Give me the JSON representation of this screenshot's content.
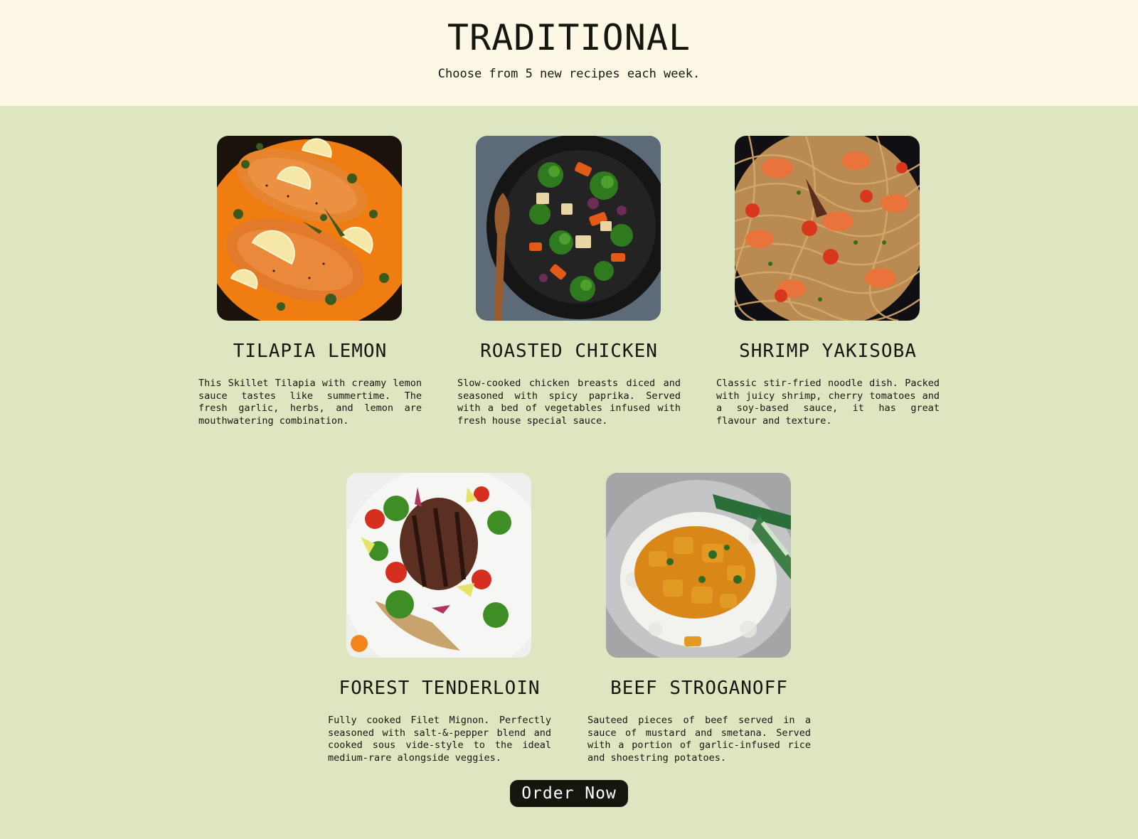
{
  "header": {
    "title": "TRADITIONAL",
    "subtitle": "Choose from 5 new recipes each week."
  },
  "recipes": [
    {
      "name": "TILAPIA LEMON",
      "description": "This Skillet Tilapia with creamy lemon sauce tastes like summertime. The fresh garlic, herbs, and lemon are mouthwatering combination.",
      "image": "salmon-lemon-photo"
    },
    {
      "name": "ROASTED CHICKEN",
      "description": "Slow-cooked chicken breasts diced and seasoned with spicy paprika. Served with a bed of vegetables infused with fresh house special sauce.",
      "image": "vegetable-skillet-photo"
    },
    {
      "name": "SHRIMP YAKISOBA",
      "description": "Classic stir-fried noodle dish. Packed with juicy shrimp, cherry tomatoes and a soy-based sauce, it has great flavour and texture.",
      "image": "shrimp-noodles-photo"
    },
    {
      "name": "FOREST TENDERLOIN",
      "description": "Fully cooked Filet Mignon. Perfectly seasoned with salt-&-pepper blend and cooked sous vide-style to the ideal medium-rare alongside veggies.",
      "image": "steak-salad-photo"
    },
    {
      "name": "BEEF STROGANOFF",
      "description": "Sauteed pieces of beef served in a sauce of mustard and smetana. Served with a portion of garlic-infused rice and shoestring potatoes.",
      "image": "curry-rice-photo"
    }
  ],
  "order_button": {
    "label": "Order Now"
  },
  "colors": {
    "header_bg": "#fdf8e6",
    "body_bg": "#dde6c0",
    "text": "#15170f",
    "button_bg": "#15170f"
  }
}
